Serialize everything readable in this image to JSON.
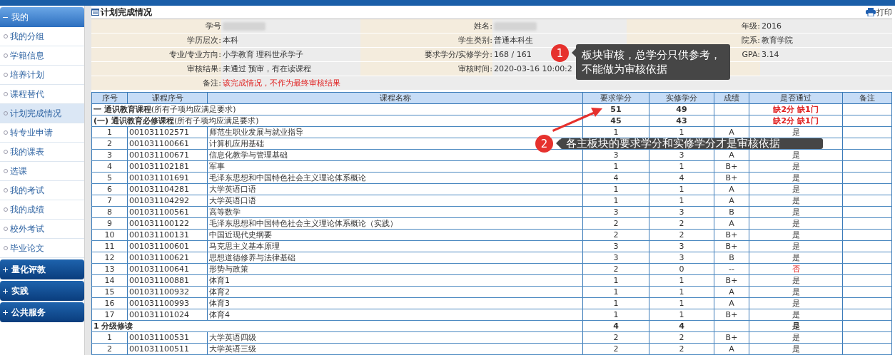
{
  "sidebar": {
    "groups": [
      {
        "title": "我的",
        "expanded": true,
        "items": [
          {
            "label": "我的分组",
            "selected": false
          },
          {
            "label": "学籍信息",
            "selected": false
          },
          {
            "label": "培养计划",
            "selected": false
          },
          {
            "label": "课程替代",
            "selected": false
          },
          {
            "label": "计划完成情况",
            "selected": true
          },
          {
            "label": "转专业申请",
            "selected": false
          },
          {
            "label": "我的课表",
            "selected": false
          },
          {
            "label": "选课",
            "selected": false
          },
          {
            "label": "我的考试",
            "selected": false
          },
          {
            "label": "我的成绩",
            "selected": false
          },
          {
            "label": "校外考试",
            "selected": false
          },
          {
            "label": "毕业论文",
            "selected": false
          }
        ]
      },
      {
        "title": "量化评教",
        "expanded": false
      },
      {
        "title": "实践",
        "expanded": false
      },
      {
        "title": "公共服务",
        "expanded": false
      }
    ]
  },
  "page": {
    "title": "计划完成情况",
    "print": "打印"
  },
  "info": [
    {
      "cells": [
        {
          "label": "学号",
          "blurred": true
        },
        {
          "label": "姓名:",
          "blurred": true
        },
        {
          "label": "年级:",
          "value": "2016"
        }
      ]
    },
    {
      "cells": [
        {
          "label": "学历层次:",
          "value": "本科"
        },
        {
          "label": "学生类别:",
          "value": "普通本科生"
        },
        {
          "label": "院系:",
          "value": "教育学院"
        }
      ]
    },
    {
      "cells": [
        {
          "label": "专业/专业方向:",
          "value": "小学教育 理科世承学子"
        },
        {
          "label": "要求学分/实修学分:",
          "value": "168 / 161"
        },
        {
          "label": "GPA:",
          "value": "3.14"
        }
      ]
    },
    {
      "cells": [
        {
          "label": "审核结果:",
          "value": "未通过 预审，有在读课程"
        },
        {
          "label": "审核时间:",
          "value": "2020-03-16 10:00:2"
        },
        {}
      ]
    }
  ],
  "remark": {
    "label": "备注:",
    "value": "该完成情况，不作为最终审核结果"
  },
  "table": {
    "columns": [
      "序号",
      "课程序号",
      "课程名称",
      "要求学分",
      "实修学分",
      "成绩",
      "是否通过",
      "备注"
    ],
    "rows": [
      {
        "kind": "group",
        "title": "一 通识教育课程",
        "note": "(所有子项均应满足要求)",
        "required": "51",
        "earned": "49",
        "result": "缺2分 缺1门",
        "passed": false
      },
      {
        "kind": "group",
        "title": "(一) 通识教育必修课程",
        "note": "(所有子项均应满足要求)",
        "required": "45",
        "earned": "43",
        "result": "缺2分 缺1门",
        "passed": false
      },
      {
        "kind": "course",
        "no": "1",
        "code": "001031102571",
        "name": "师范生职业发展与就业指导",
        "required": "1",
        "earned": "1",
        "grade": "A",
        "result": "是",
        "passed": true
      },
      {
        "kind": "course",
        "no": "2",
        "code": "001031100661",
        "name": "计算机应用基础"
      },
      {
        "kind": "course",
        "no": "3",
        "code": "001031100671",
        "name": "信息化教学与管理基础",
        "required": "3",
        "earned": "3",
        "grade": "A",
        "result": "是",
        "passed": true
      },
      {
        "kind": "course",
        "no": "4",
        "code": "001031102181",
        "name": "军事",
        "required": "1",
        "earned": "1",
        "grade": "B+",
        "result": "是",
        "passed": true
      },
      {
        "kind": "course",
        "no": "5",
        "code": "001031101691",
        "name": "毛泽东思想和中国特色社会主义理论体系概论",
        "required": "4",
        "earned": "4",
        "grade": "B+",
        "result": "是",
        "passed": true
      },
      {
        "kind": "course",
        "no": "6",
        "code": "001031104281",
        "name": "大学英语口语",
        "required": "1",
        "earned": "1",
        "grade": "A",
        "result": "是",
        "passed": true
      },
      {
        "kind": "course",
        "no": "7",
        "code": "001031104292",
        "name": "大学英语口语",
        "required": "1",
        "earned": "1",
        "grade": "A",
        "result": "是",
        "passed": true
      },
      {
        "kind": "course",
        "no": "8",
        "code": "001031100561",
        "name": "高等数学",
        "required": "3",
        "earned": "3",
        "grade": "B",
        "result": "是",
        "passed": true
      },
      {
        "kind": "course",
        "no": "9",
        "code": "001031100122",
        "name": "毛泽东思想和中国特色社会主义理论体系概论（实践）",
        "required": "2",
        "earned": "2",
        "grade": "A",
        "result": "是",
        "passed": true
      },
      {
        "kind": "course",
        "no": "10",
        "code": "001031100131",
        "name": "中国近现代史纲要",
        "required": "2",
        "earned": "2",
        "grade": "B+",
        "result": "是",
        "passed": true
      },
      {
        "kind": "course",
        "no": "11",
        "code": "001031100601",
        "name": "马克思主义基本原理",
        "required": "3",
        "earned": "3",
        "grade": "B+",
        "result": "是",
        "passed": true
      },
      {
        "kind": "course",
        "no": "12",
        "code": "001031100621",
        "name": "思想道德修养与法律基础",
        "required": "3",
        "earned": "3",
        "grade": "B",
        "result": "是",
        "passed": true
      },
      {
        "kind": "course",
        "no": "13",
        "code": "001031100641",
        "name": "形势与政策",
        "required": "2",
        "earned": "0",
        "grade": "--",
        "result": "否",
        "passed": false
      },
      {
        "kind": "course",
        "no": "14",
        "code": "001031100881",
        "name": "体育1",
        "required": "1",
        "earned": "1",
        "grade": "B+",
        "result": "是",
        "passed": true
      },
      {
        "kind": "course",
        "no": "15",
        "code": "001031100932",
        "name": "体育2",
        "required": "1",
        "earned": "1",
        "grade": "A",
        "result": "是",
        "passed": true
      },
      {
        "kind": "course",
        "no": "16",
        "code": "001031100993",
        "name": "体育3",
        "required": "1",
        "earned": "1",
        "grade": "A",
        "result": "是",
        "passed": true
      },
      {
        "kind": "course",
        "no": "17",
        "code": "001031101024",
        "name": "体育4",
        "required": "1",
        "earned": "1",
        "grade": "B+",
        "result": "是",
        "passed": true
      },
      {
        "kind": "group",
        "title": "1 分级修读",
        "required": "4",
        "earned": "4",
        "result": "是",
        "passed": true
      },
      {
        "kind": "course",
        "no": "1",
        "code": "001031100531",
        "name": "大学英语四级",
        "required": "2",
        "earned": "2",
        "grade": "B+",
        "result": "是",
        "passed": true
      },
      {
        "kind": "course",
        "no": "2",
        "code": "001031100511",
        "name": "大学英语三级",
        "required": "2",
        "earned": "2",
        "grade": "A",
        "result": "是",
        "passed": true
      }
    ]
  },
  "annotations": [
    {
      "number": "1",
      "text": "板块审核，总学分只供参考，不能做为审核依据"
    },
    {
      "number": "2",
      "text": "各主板块的要求学分和实修学分才是审核依据"
    }
  ]
}
